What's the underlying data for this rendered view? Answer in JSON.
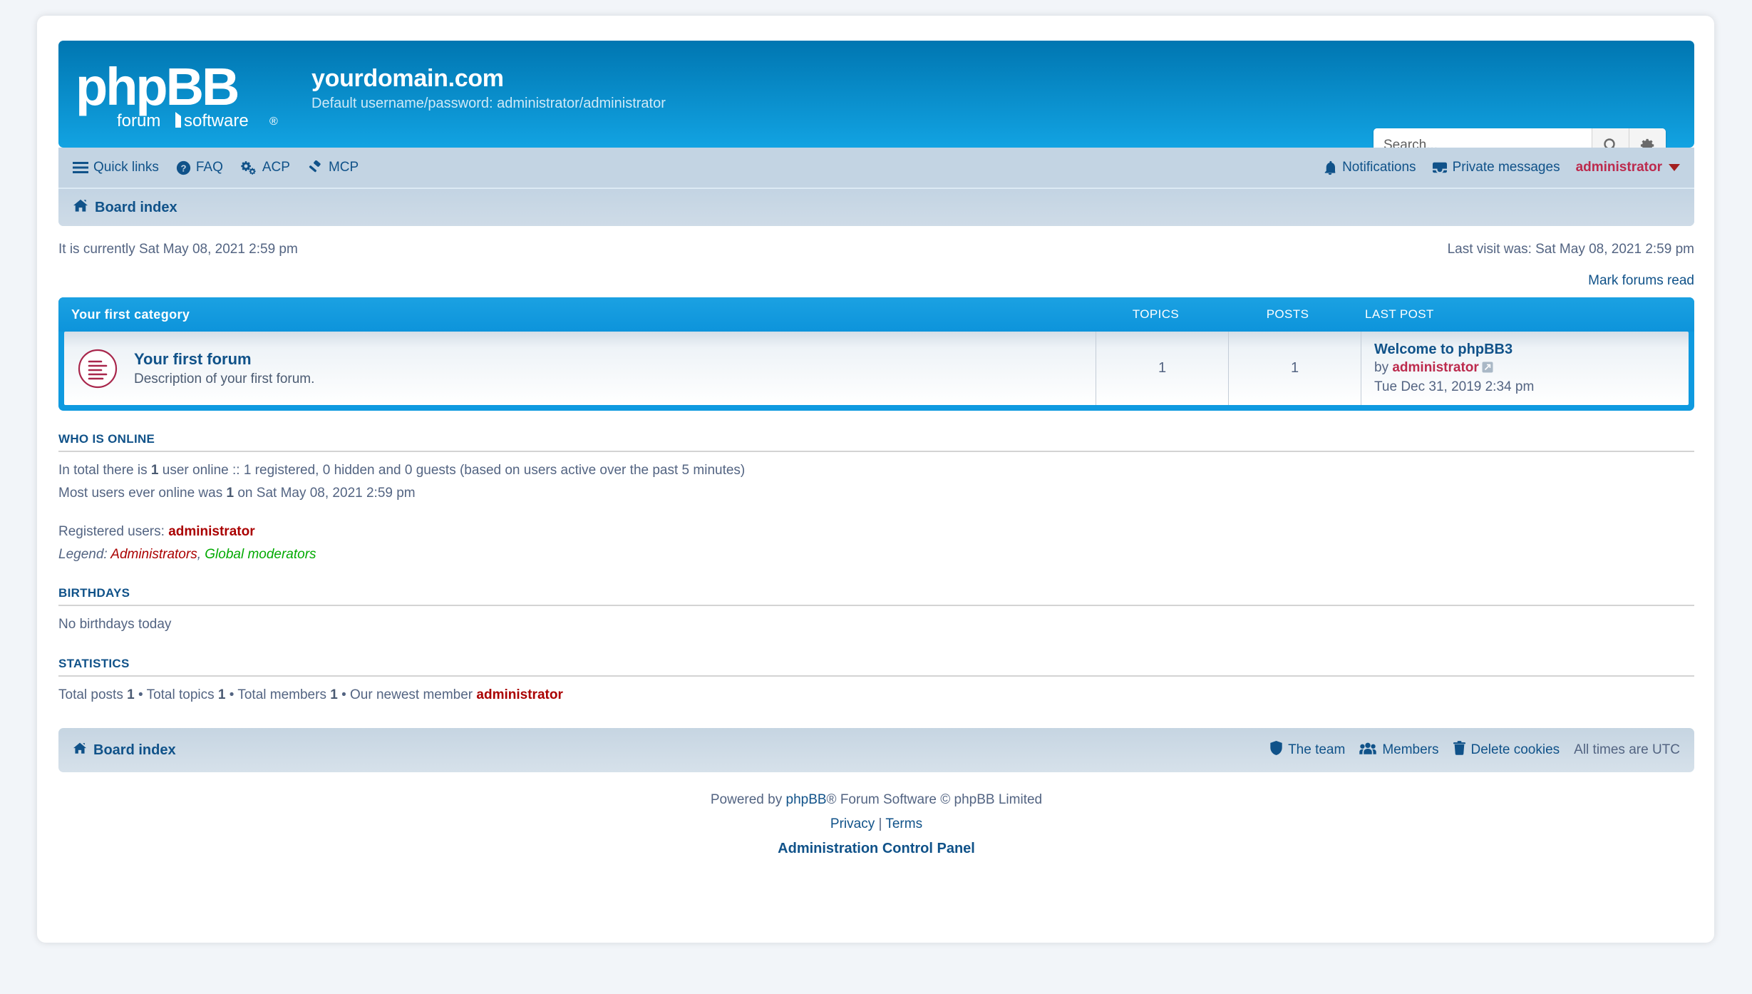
{
  "header": {
    "logo_main": "phpBB",
    "logo_sub_left": "forum",
    "logo_sub_right": "software",
    "logo_reg": "®",
    "site_title": "yourdomain.com",
    "site_description": "Default username/password: administrator/administrator",
    "search_placeholder": "Search...",
    "search_value": "",
    "search_icon": "search-icon",
    "search_advanced_icon": "gear-icon"
  },
  "nav": {
    "left": [
      {
        "label": "Quick links",
        "icon": "hamburger-icon"
      },
      {
        "label": "FAQ",
        "icon": "question-circle-icon"
      },
      {
        "label": "ACP",
        "icon": "cogs-icon"
      },
      {
        "label": "MCP",
        "icon": "gavel-icon"
      }
    ],
    "right": [
      {
        "label": "Notifications",
        "icon": "bell-icon"
      },
      {
        "label": "Private messages",
        "icon": "inbox-icon"
      }
    ],
    "user": "administrator",
    "breadcrumb": "Board index"
  },
  "infobar": {
    "current_time": "It is currently Sat May 08, 2021 2:59 pm",
    "last_visit": "Last visit was: Sat May 08, 2021 2:59 pm",
    "mark_forums_read": "Mark forums read"
  },
  "forumlist": {
    "category": "Your first category",
    "columns": {
      "topics": "TOPICS",
      "posts": "POSTS",
      "lastpost": "LAST POST"
    },
    "rows": [
      {
        "icon": "forum-read-icon",
        "title": "Your first forum",
        "description": "Description of your first forum.",
        "topics": "1",
        "posts": "1",
        "lastpost_title": "Welcome to phpBB3",
        "lastpost_by_label": "by",
        "lastpost_author": "administrator",
        "lastpost_goto_icon": "goto-post-icon",
        "lastpost_time": "Tue Dec 31, 2019 2:34 pm"
      }
    ]
  },
  "who_is_online": {
    "title": "WHO IS ONLINE",
    "line1_a": "In total there is ",
    "line1_count": "1",
    "line1_b": " user online :: 1 registered, 0 hidden and 0 guests (based on users active over the past 5 minutes)",
    "line2_a": "Most users ever online was ",
    "line2_count": "1",
    "line2_b": " on Sat May 08, 2021 2:59 pm",
    "registered_label": "Registered users: ",
    "registered_users": "administrator",
    "legend_label": "Legend: ",
    "legend_admins": "Administrators",
    "legend_sep": ", ",
    "legend_gmods": "Global moderators"
  },
  "birthdays": {
    "title": "BIRTHDAYS",
    "text": "No birthdays today"
  },
  "statistics": {
    "title": "STATISTICS",
    "total_posts_label": "Total posts ",
    "total_posts": "1",
    "sep1": " • ",
    "total_topics_label": "Total topics ",
    "total_topics": "1",
    "sep2": " • ",
    "total_members_label": "Total members ",
    "total_members": "1",
    "sep3": " • ",
    "newest_label": "Our newest member ",
    "newest_member": "administrator"
  },
  "footer": {
    "board_index": "Board index",
    "links": [
      {
        "label": "The team",
        "icon": "shield-icon"
      },
      {
        "label": "Members",
        "icon": "users-icon"
      },
      {
        "label": "Delete cookies",
        "icon": "trash-icon"
      }
    ],
    "timezone": "All times are UTC",
    "credit_pre": "Powered by ",
    "credit_link": "phpBB",
    "credit_post": "® Forum Software © phpBB Limited",
    "privacy": "Privacy",
    "pipe": " | ",
    "terms": "Terms",
    "acp": "Administration Control Panel"
  },
  "colors": {
    "header_top": "#0076b1",
    "header_bottom": "#12a3e2",
    "nav_bg": "#c3d4e3",
    "link": "#105289",
    "admin_red": "#bc2a4d",
    "legend_admin": "#aa0000",
    "legend_gmod": "#00aa00",
    "category_bar": "#1ba1e2",
    "page_bg": "#f2f5f9"
  }
}
